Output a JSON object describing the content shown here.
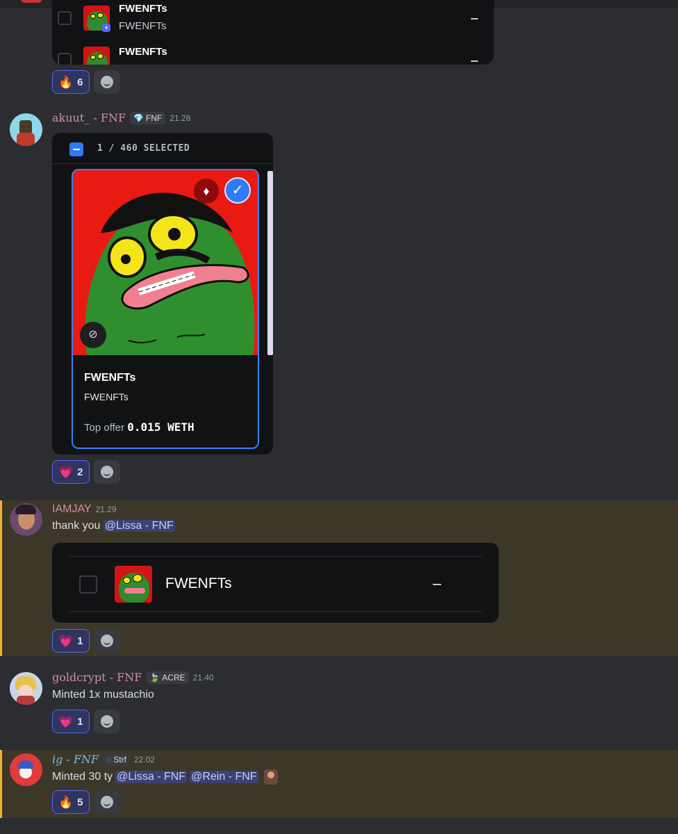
{
  "embed_top": {
    "rows": [
      {
        "title": "FWENFTs",
        "subtitle": "FWENFTs",
        "dash": "–"
      },
      {
        "title": "FWENFTs",
        "dash": "–"
      }
    ]
  },
  "reactions": {
    "first": {
      "emoji": "🔥",
      "count": "6"
    },
    "akuut": {
      "emoji": "💗",
      "count": "2"
    },
    "iamjay": {
      "emoji": "💗",
      "count": "1"
    },
    "goldcrypt": {
      "emoji": "💗",
      "count": "1"
    },
    "ig": {
      "emoji": "🔥",
      "count": "5"
    }
  },
  "messages": {
    "akuut": {
      "username": "akuut_ - FNF",
      "tag": "FNF",
      "tag_icon": "💎",
      "time": "21.28",
      "selection": {
        "text": "1 / 460 SELECTED"
      },
      "nft": {
        "title": "FWENFTs",
        "collection": "FWENFTs",
        "offer_label": "Top offer",
        "offer_value": "0.015 WETH"
      }
    },
    "iamjay": {
      "username": "IAMJAY",
      "time": "21.29",
      "text": "thank you",
      "mention": "@Lissa - FNF",
      "embed": {
        "title": "FWENFTs",
        "dash": "–"
      }
    },
    "goldcrypt": {
      "username": "goldcrypt - FNF",
      "tag": "ACRE",
      "tag_icon": "🍃",
      "time": "21.40",
      "text": "Minted  1x mustachio"
    },
    "ig": {
      "username": "ig -  FNF",
      "tag": "Strf",
      "tag_icon": "◌",
      "time": "22.02",
      "text": "Minted 30 ty",
      "mentions": [
        "@Lissa - FNF",
        "@Rein - FNF"
      ]
    }
  },
  "colors": {
    "background": "#2b2d31",
    "highlight": "#3c3728",
    "highlight_bar": "#f0b232",
    "accent_blue": "#3b82f6",
    "reaction_bg": "#2f3460"
  }
}
